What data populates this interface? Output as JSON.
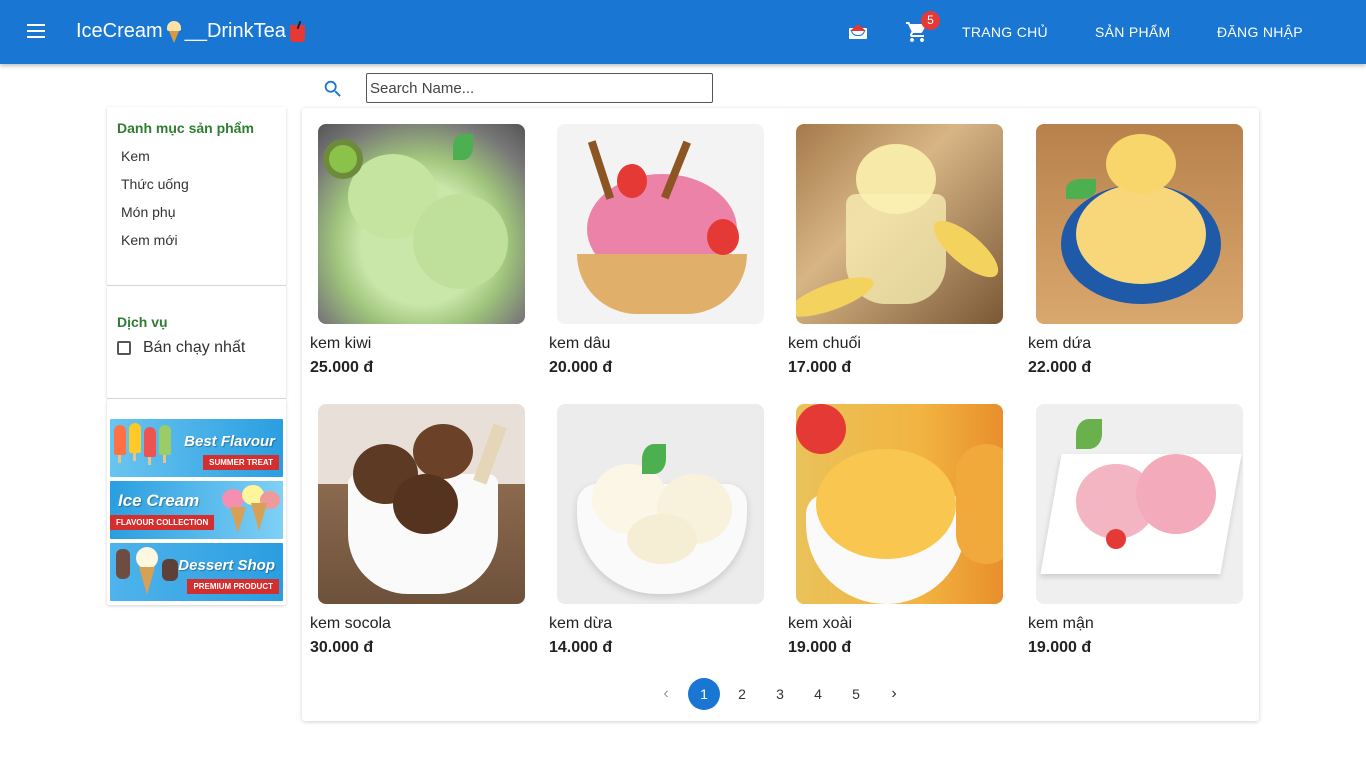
{
  "header": {
    "brand_part1": "IceCream",
    "brand_part2": "__DrinkTea",
    "cart_count": "5",
    "nav": [
      "TRANG CHỦ",
      "SẢN PHẨM",
      "ĐĂNG NHẬP"
    ],
    "color": "#1976d2"
  },
  "search": {
    "placeholder": "Search Name..."
  },
  "sidebar": {
    "category_title": "Danh mục sản phẩm",
    "categories": [
      "Kem",
      "Thức uống",
      "Món phụ",
      "Kem mới"
    ],
    "service_title": "Dịch vụ",
    "best_seller_label": "Bán chạy nhất",
    "banners": [
      {
        "title": "Best Flavour",
        "sub": "SUMMER TREAT"
      },
      {
        "title": "Ice Cream",
        "sub": "FLAVOUR COLLECTION"
      },
      {
        "title": "Dessert Shop",
        "sub": "PREMIUM PRODUCT"
      }
    ]
  },
  "products": [
    {
      "name": "kem kiwi",
      "price": "25.000 đ",
      "icon": "kiwi-ice-cream-image"
    },
    {
      "name": "kem dâu",
      "price": "20.000 đ",
      "icon": "strawberry-ice-cream-image"
    },
    {
      "name": "kem chuối",
      "price": "17.000 đ",
      "icon": "banana-ice-cream-image"
    },
    {
      "name": "kem dứa",
      "price": "22.000 đ",
      "icon": "pineapple-ice-cream-image"
    },
    {
      "name": "kem socola",
      "price": "30.000 đ",
      "icon": "chocolate-ice-cream-image"
    },
    {
      "name": "kem dừa",
      "price": "14.000 đ",
      "icon": "coconut-ice-cream-image"
    },
    {
      "name": "kem xoài",
      "price": "19.000 đ",
      "icon": "mango-ice-cream-image"
    },
    {
      "name": "kem mận",
      "price": "19.000 đ",
      "icon": "plum-ice-cream-image"
    }
  ],
  "pagination": {
    "pages": [
      "1",
      "2",
      "3",
      "4",
      "5"
    ],
    "current": "1"
  }
}
